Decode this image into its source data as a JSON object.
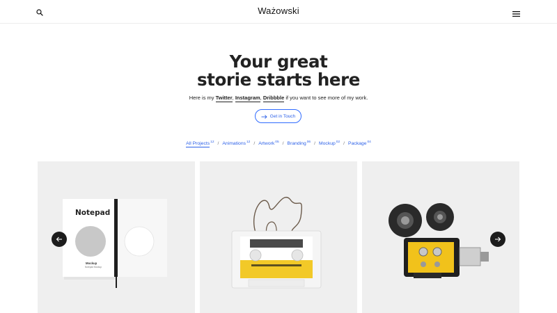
{
  "header": {
    "logo": "Ważowski",
    "search_icon": "search-icon",
    "menu_icon": "hamburger-menu-icon"
  },
  "hero": {
    "title_line1": "Your great",
    "title_line2": "storie starts here",
    "subtitle_prefix": "Here is my ",
    "link_twitter": "Twitter",
    "comma1": ", ",
    "link_instagram": "Instagram",
    "comma2": ", ",
    "link_dribbble": "Dribbble",
    "subtitle_suffix": " if you want to see more of my work.",
    "cta_label": "Get in Touch",
    "cta_icon": "arrow-right-icon"
  },
  "filters": [
    {
      "label": "All Projects",
      "count": "12",
      "active": true
    },
    {
      "label": "Animations",
      "count": "12",
      "active": false
    },
    {
      "label": "Artwork",
      "count": "05",
      "active": false
    },
    {
      "label": "Branding",
      "count": "06",
      "active": false
    },
    {
      "label": "Mockup",
      "count": "02",
      "active": false
    },
    {
      "label": "Package",
      "count": "04",
      "active": false
    }
  ],
  "filter_separator": "/",
  "portfolio": {
    "cards": [
      {
        "subject": "notepad-mockup",
        "text_title": "Notepad",
        "text_small1": "Mockup",
        "text_small2": "Notepad Mockup"
      },
      {
        "subject": "cassette-tape-mockup"
      },
      {
        "subject": "vintage-film-camera"
      }
    ],
    "prev_icon": "arrow-left-icon",
    "next_icon": "arrow-right-icon"
  },
  "colors": {
    "accent": "#2a5fe8",
    "text": "#222222",
    "card_bg": "#efefef",
    "arrow_bg": "#1c1c1c",
    "tape_yellow": "#f2c928",
    "camera_yellow": "#f1c21b"
  }
}
